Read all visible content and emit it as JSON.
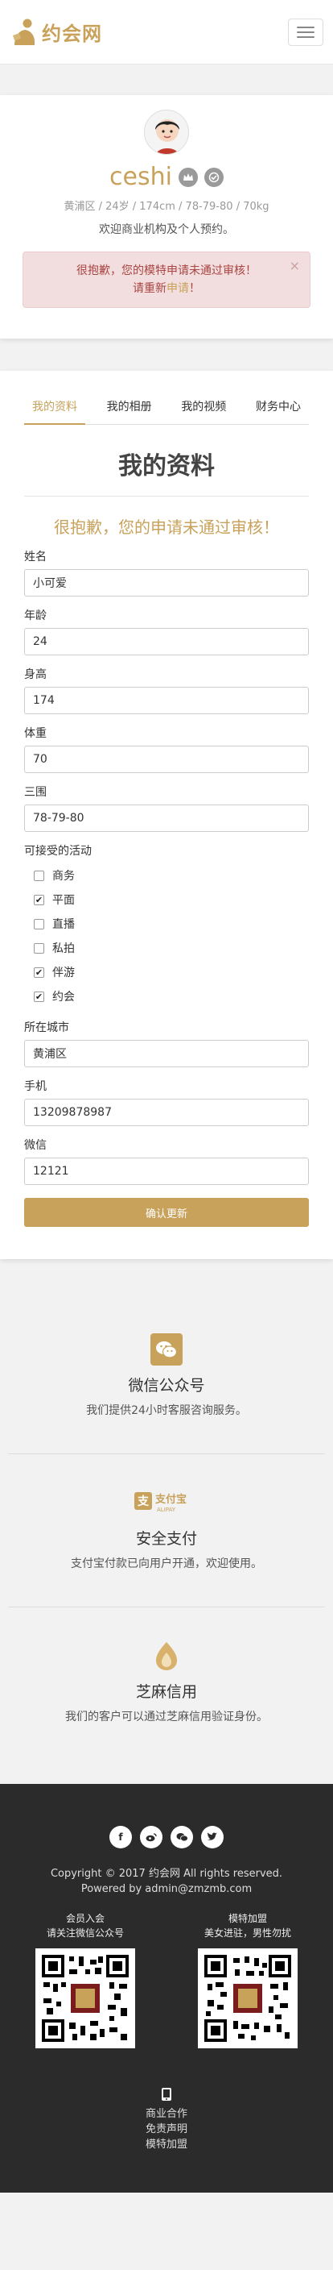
{
  "header": {
    "logo_text": "约会网",
    "menu_icon": "hamburger-icon",
    "accent_color": "#c8a25b"
  },
  "profile": {
    "name": "ceshi",
    "stats": "黄浦区 / 24岁 / 174cm / 78-79-80 / 70kg",
    "welcome": "欢迎商业机构及个人预约。",
    "alert_line1": "很抱歉，您的模特申请未通过审核！",
    "alert_line2_prefix": "请重新",
    "alert_line2_link": "申请",
    "alert_line2_suffix": "！",
    "alert_close": "×"
  },
  "tabs": [
    {
      "label": "我的资料",
      "active": true
    },
    {
      "label": "我的相册",
      "active": false
    },
    {
      "label": "我的视频",
      "active": false
    },
    {
      "label": "财务中心",
      "active": false
    }
  ],
  "main": {
    "title": "我的资料",
    "warning": "很抱歉，您的申请未通过审核！"
  },
  "form": {
    "name_label": "姓名",
    "name_value": "小可爱",
    "age_label": "年龄",
    "age_value": "24",
    "height_label": "身高",
    "height_value": "174",
    "weight_label": "体重",
    "weight_value": "70",
    "measure_label": "三围",
    "measure_value": "78-79-80",
    "activities_label": "可接受的活动",
    "activities": [
      {
        "label": "商务",
        "checked": false
      },
      {
        "label": "平面",
        "checked": true
      },
      {
        "label": "直播",
        "checked": false
      },
      {
        "label": "私拍",
        "checked": false
      },
      {
        "label": "伴游",
        "checked": true
      },
      {
        "label": "约会",
        "checked": true
      }
    ],
    "city_label": "所在城市",
    "city_value": "黄浦区",
    "phone_label": "手机",
    "phone_value": "13209878987",
    "wechat_label": "微信",
    "wechat_value": "12121",
    "submit_label": "确认更新"
  },
  "features": [
    {
      "icon": "wechat-icon",
      "title": "微信公众号",
      "desc": "我们提供24小时客服咨询服务。"
    },
    {
      "icon": "alipay-icon",
      "title": "安全支付",
      "desc": "支付宝付款已向用户开通，欢迎使用。",
      "icon_text": "支付宝",
      "icon_subtext": "ALIPAY"
    },
    {
      "icon": "sesame-credit-icon",
      "title": "芝麻信用",
      "desc": "我们的客户可以通过芝麻信用验证身份。"
    }
  ],
  "footer": {
    "social": [
      "facebook-icon",
      "weibo-icon",
      "wechat-icon",
      "twitter-icon"
    ],
    "copyright": "Copyright © 2017 约会网 All rights reserved.",
    "powered": "Powered by admin@zmzmb.com",
    "qr_left_title": "会员入会",
    "qr_left_sub": "请关注微信公众号",
    "qr_right_title": "模特加盟",
    "qr_right_sub": "美女进驻，男性勿扰",
    "links": [
      "商业合作",
      "免责声明",
      "模特加盟"
    ]
  }
}
